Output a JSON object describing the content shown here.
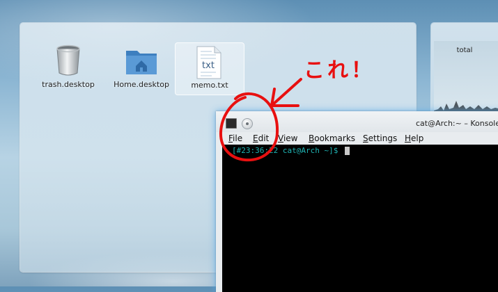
{
  "desktop": {
    "icons": [
      {
        "label": "trash.desktop",
        "icon": "trash-icon"
      },
      {
        "label": "Home.desktop",
        "icon": "home-folder-icon"
      },
      {
        "label": "memo.txt",
        "icon": "text-file-icon",
        "badge": "txt"
      }
    ]
  },
  "system_monitor": {
    "label": "total"
  },
  "konsole": {
    "title": "cat@Arch:~ – Konsole",
    "menu": [
      "File",
      "Edit",
      "View",
      "Bookmarks",
      "Settings",
      "Help"
    ],
    "prompt": "[#23:36:22 cat@Arch ~]$ "
  },
  "annotation": {
    "text": "これ！",
    "color": "#e81010"
  }
}
